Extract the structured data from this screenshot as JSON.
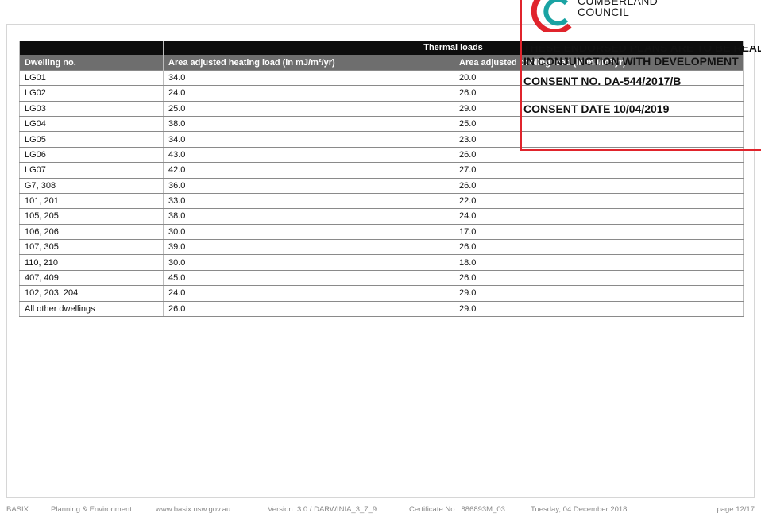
{
  "table": {
    "band_title": "Thermal loads",
    "columns": [
      "Dwelling no.",
      "Area adjusted heating load (in mJ/m²/yr)",
      "Area adjusted cooling load (in mJ/m²/yr)"
    ],
    "rows": [
      [
        "LG01",
        "34.0",
        "20.0"
      ],
      [
        "LG02",
        "24.0",
        "26.0"
      ],
      [
        "LG03",
        "25.0",
        "29.0"
      ],
      [
        "LG04",
        "38.0",
        "25.0"
      ],
      [
        "LG05",
        "34.0",
        "23.0"
      ],
      [
        "LG06",
        "43.0",
        "26.0"
      ],
      [
        "LG07",
        "42.0",
        "27.0"
      ],
      [
        "G7, 308",
        "36.0",
        "26.0"
      ],
      [
        "101, 201",
        "33.0",
        "22.0"
      ],
      [
        "105, 205",
        "38.0",
        "24.0"
      ],
      [
        "106, 206",
        "30.0",
        "17.0"
      ],
      [
        "107, 305",
        "39.0",
        "26.0"
      ],
      [
        "110, 210",
        "30.0",
        "18.0"
      ],
      [
        "407, 409",
        "45.0",
        "26.0"
      ],
      [
        "102, 203, 204",
        "24.0",
        "29.0"
      ],
      [
        "All other dwellings",
        "26.0",
        "29.0"
      ]
    ]
  },
  "stamp": {
    "council_line1": "CUMBERLAND",
    "council_line2": "COUNCIL",
    "endorse_line1": "THESE ENDORSED PLANS ARE TO BE READ",
    "endorse_line2": "IN CONJUNCTION WITH DEVELOPMENT",
    "consent_no": "CONSENT NO. DA-544/2017/B",
    "consent_date": "CONSENT DATE 10/04/2019",
    "border_color": "#e0242c",
    "logo_colors": [
      "#e0242c",
      "#1aa3a3"
    ]
  },
  "footer": {
    "program": "BASIX",
    "department": "Planning & Environment",
    "website": "www.basix.nsw.gov.au",
    "version": "Version: 3.0 / DARWINIA_3_7_9",
    "certificate": "Certificate No.: 886893M_03",
    "date": "Tuesday, 04 December 2018",
    "page": "page 12/17"
  }
}
